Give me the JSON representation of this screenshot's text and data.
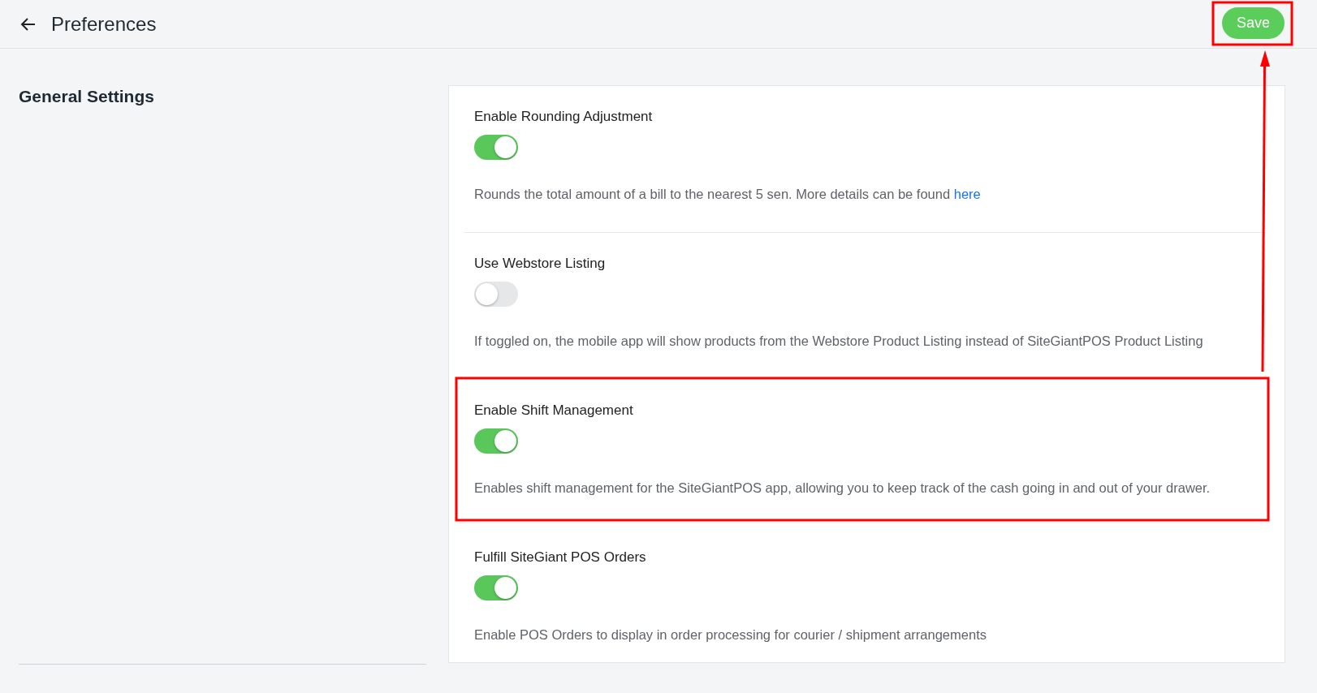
{
  "header": {
    "title": "Preferences",
    "save_button": "Save"
  },
  "section": {
    "title": "General Settings"
  },
  "settings": [
    {
      "label": "Enable Rounding Adjustment",
      "on": true,
      "description": "Rounds the total amount of a bill to the nearest 5 sen. More details can be found",
      "link": "here",
      "separated": true
    },
    {
      "label": "Use Webstore Listing",
      "on": false,
      "description": "If toggled on, the mobile app will show products from the Webstore Product Listing instead of SiteGiantPOS Product Listing",
      "separated": false
    },
    {
      "label": "Enable Shift Management",
      "on": true,
      "description": "Enables shift management for the SiteGiantPOS app, allowing you to keep track of the cash going in and out of your drawer.",
      "separated": false
    },
    {
      "label": "Fulfill SiteGiant POS Orders",
      "on": true,
      "description": "Enable POS Orders to display in order processing for courier / shipment arrangements",
      "separated": false
    }
  ]
}
